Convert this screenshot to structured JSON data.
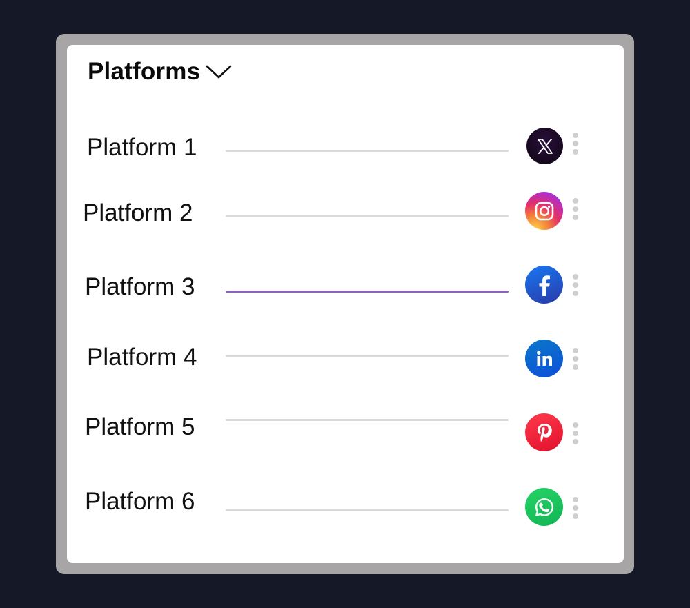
{
  "panel": {
    "title": "Platforms",
    "chevron_icon": "chevron-down-icon"
  },
  "platforms": [
    {
      "label": "Platform 1",
      "icon": "x-twitter-icon",
      "active": false
    },
    {
      "label": "Platform 2",
      "icon": "instagram-icon",
      "active": false
    },
    {
      "label": "Platform 3",
      "icon": "facebook-icon",
      "active": true
    },
    {
      "label": "Platform 4",
      "icon": "linkedin-icon",
      "active": false
    },
    {
      "label": "Platform 5",
      "icon": "pinterest-icon",
      "active": false
    },
    {
      "label": "Platform 6",
      "icon": "whatsapp-icon",
      "active": false
    }
  ],
  "colors": {
    "background": "#151826",
    "frame": "#a8a5a6",
    "card": "#ffffff",
    "line_inactive": "#d9d9db",
    "line_active": "#8a63bd",
    "x": "#1a0a26",
    "facebook": "#1f5ddc",
    "linkedin": "#0b66d4",
    "pinterest": "#f0233c",
    "whatsapp": "#1fc760"
  }
}
